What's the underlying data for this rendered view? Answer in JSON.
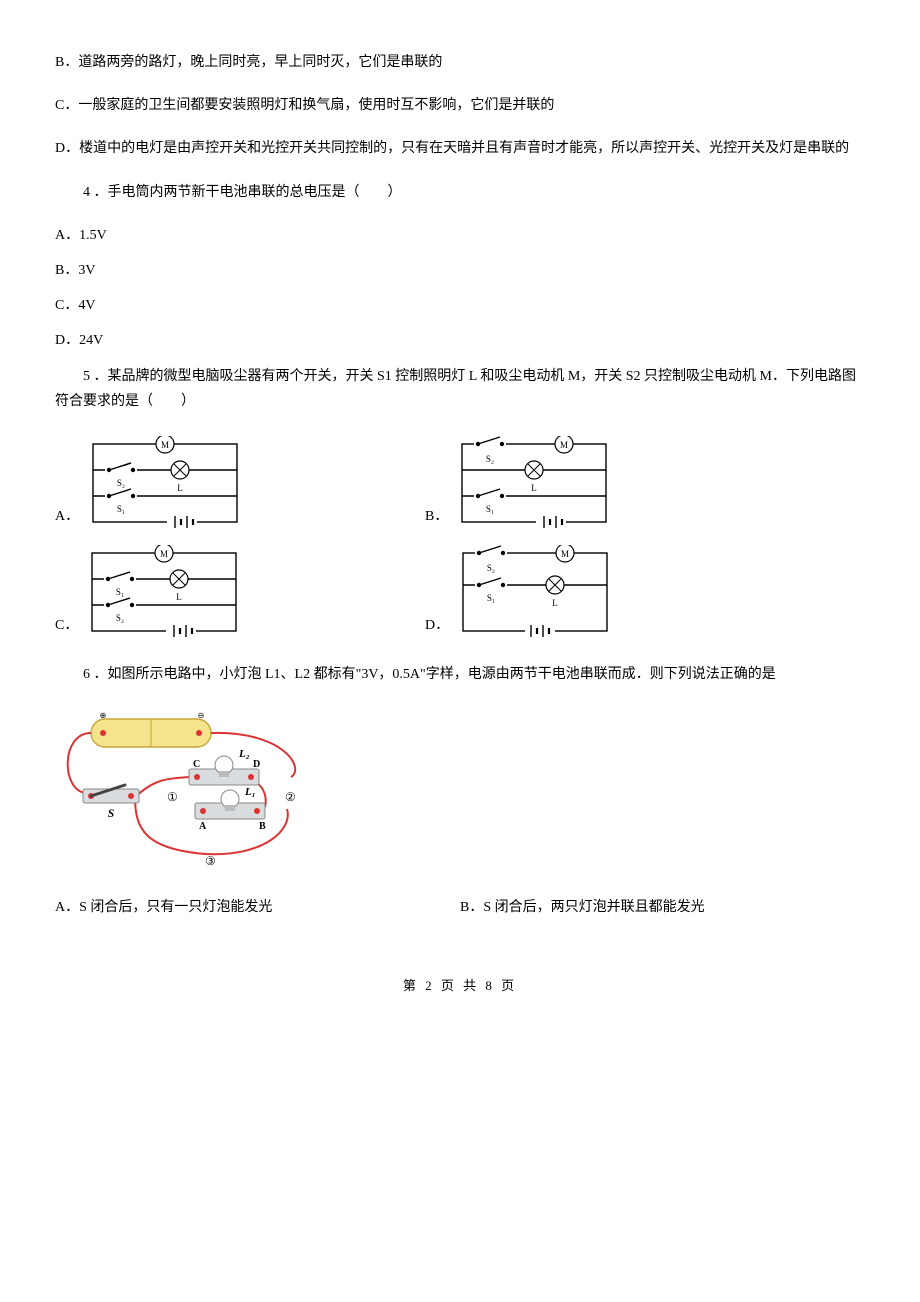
{
  "q3": {
    "optB": "B．道路两旁的路灯，晚上同时亮，早上同时灭，它们是串联的",
    "optC": "C．一般家庭的卫生间都要安装照明灯和换气扇，使用时互不影响，它们是并联的",
    "optD": "D．楼道中的电灯是由声控开关和光控开关共同控制的，只有在天暗并且有声音时才能亮，所以声控开关、光控开关及灯是串联的"
  },
  "q4": {
    "stem": "4 ．手电筒内两节新干电池串联的总电压是（　　）",
    "optA": "A．1.5V",
    "optB": "B．3V",
    "optC": "C．4V",
    "optD": "D．24V"
  },
  "q5": {
    "stem": "5 ．某品牌的微型电脑吸尘器有两个开关，开关 S1 控制照明灯 L 和吸尘电动机 M，开关 S2 只控制吸尘电动机 M．下列电路图符合要求的是（　　）",
    "labelA": "A．",
    "labelB": "B．",
    "labelC": "C．",
    "labelD": "D．",
    "circuits": {
      "A": {
        "top": "S₂",
        "bottom": "S₁",
        "motor": "M",
        "lamp": "L"
      },
      "B": {
        "top": "S₂",
        "bottom": "S₁",
        "motor": "M",
        "lamp": "L"
      },
      "C": {
        "top": "S₁",
        "bottom": "S₂",
        "motor": "M",
        "lamp": "L"
      },
      "D": {
        "top": "S₂",
        "bottom": "S₁",
        "motor": "M",
        "lamp": "L"
      }
    }
  },
  "q6": {
    "stem": "6 ．如图所示电路中，小灯泡 L1、L2 都标有\"3V，0.5A\"字样，电源由两节干电池串联而成．则下列说法正确的是",
    "fig": {
      "L1": "L₁",
      "L2": "L₂",
      "S": "S",
      "A": "A",
      "B": "B",
      "C": "C",
      "D": "D",
      "n1": "①",
      "n2": "②",
      "n3": "③"
    },
    "optA": "A．S 闭合后，只有一只灯泡能发光",
    "optB": "B．S 闭合后，两只灯泡并联且都能发光"
  },
  "footer": "第 2 页 共 8 页"
}
